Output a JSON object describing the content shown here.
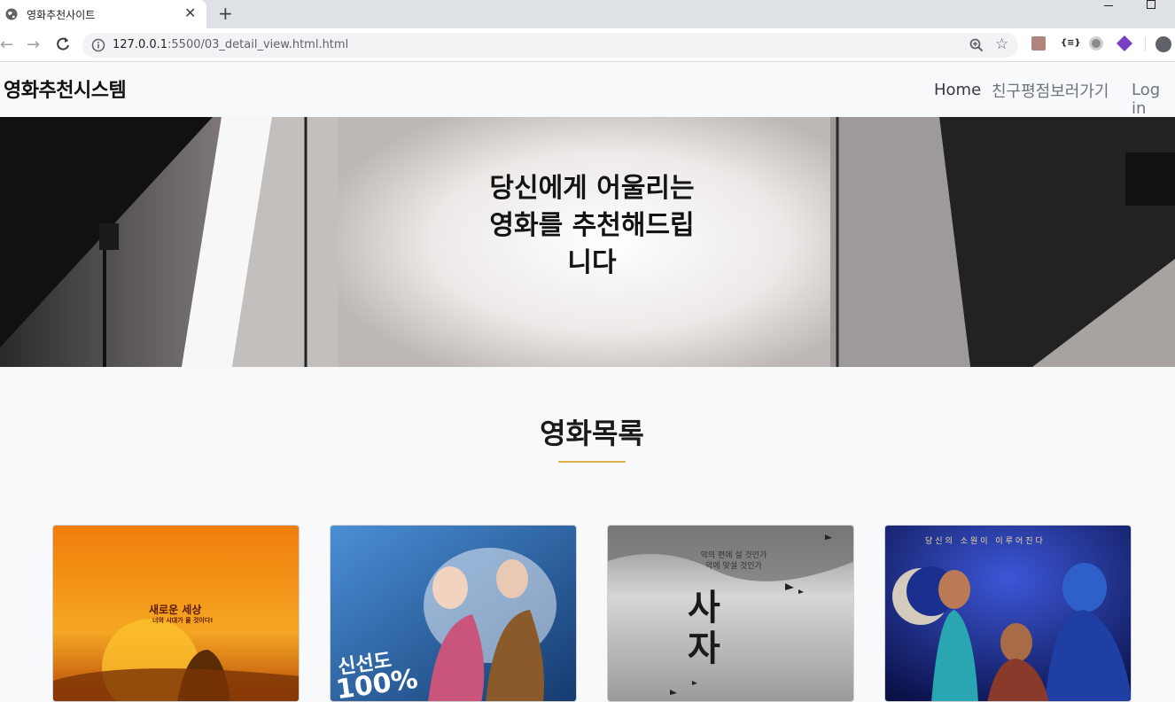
{
  "browser": {
    "tab_title": "영화추천사이트",
    "url_host": "127.0.0.1",
    "url_path": ":5500/03_detail_view.html.html",
    "ext_json_label": "{≡}"
  },
  "navbar": {
    "brand": "영화추천시스템",
    "items": [
      "Home",
      "친구평점보러가기",
      "Log in"
    ]
  },
  "hero": {
    "line1": "당신에게 어울리는",
    "line2": "영화를 추천해드립",
    "line3": "니다"
  },
  "section": {
    "title": "영화목록"
  },
  "movies": [
    {
      "name": "lion-king",
      "tagline": "새로운 세상",
      "subtagline": "너의 시대가 올 것이다!",
      "colors": [
        "#f28a0c",
        "#c2410c"
      ]
    },
    {
      "name": "along-with-gods",
      "badge": "신선도",
      "badge2": "100%",
      "colors": [
        "#2f78c4",
        "#173f78"
      ]
    },
    {
      "name": "divine-fury",
      "quote": "악의 편에 설 것인가 악에 맞설 것인가",
      "title": "사자",
      "colors": [
        "#cfcfcf",
        "#8d8d8d"
      ]
    },
    {
      "name": "aladdin",
      "tagline": "당신의 소원이 이루어진다",
      "colors": [
        "#2434a8",
        "#0e1550"
      ]
    }
  ]
}
